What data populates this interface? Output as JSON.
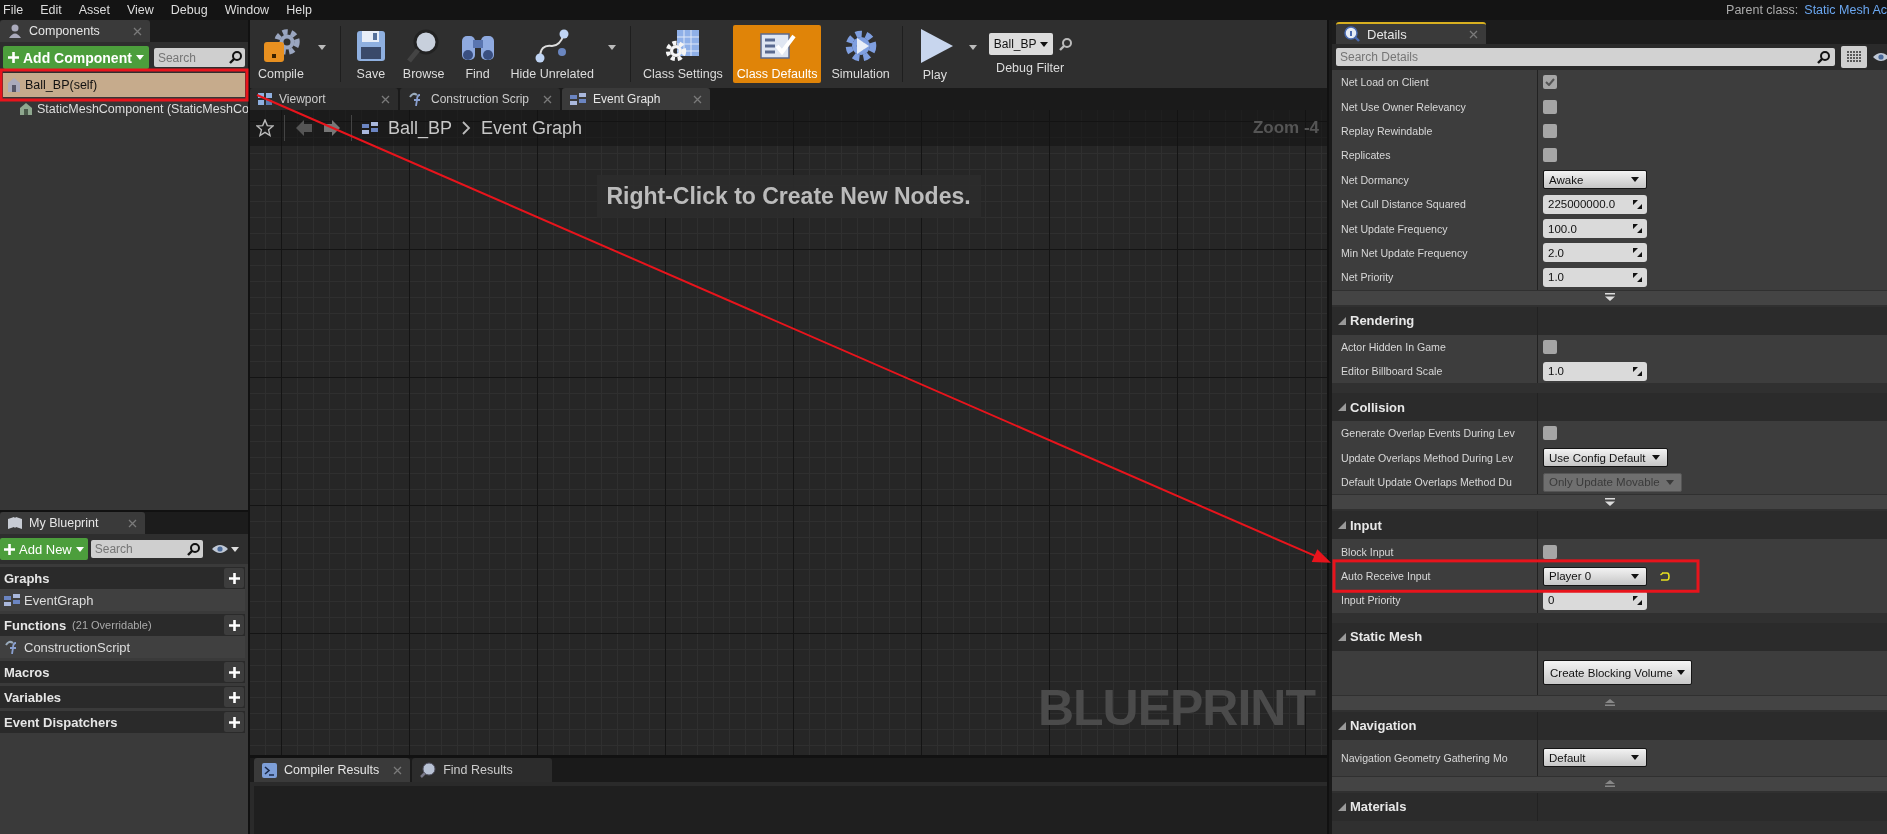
{
  "menu_bar": {
    "items": [
      "File",
      "Edit",
      "Asset",
      "View",
      "Debug",
      "Window",
      "Help"
    ],
    "parent_class_label": "Parent class:",
    "parent_class": "Static Mesh Ac"
  },
  "components_panel": {
    "tab": "Components",
    "add_button": "Add Component",
    "search_placeholder": "Search",
    "tree": [
      {
        "label": "Ball_BP(self)",
        "selected": true,
        "children": [
          {
            "label": "StaticMeshComponent (StaticMeshCo",
            "selected": false
          }
        ]
      }
    ]
  },
  "toolbar": {
    "groups": [
      [
        {
          "label": "Compile",
          "kind": "compile",
          "dropdown": true,
          "selected": false
        }
      ],
      [
        {
          "label": "Save",
          "kind": "save",
          "dropdown": false,
          "selected": false
        },
        {
          "label": "Browse",
          "kind": "browse",
          "dropdown": false,
          "selected": false
        },
        {
          "label": "Find",
          "kind": "find",
          "dropdown": false,
          "selected": false
        },
        {
          "label": "Hide Unrelated",
          "kind": "hide_unrelated",
          "dropdown": true,
          "selected": false
        }
      ],
      [
        {
          "label": "Class Settings",
          "kind": "class_settings",
          "dropdown": false,
          "selected": false
        },
        {
          "label": "Class Defaults",
          "kind": "class_defaults",
          "dropdown": false,
          "selected": true
        },
        {
          "label": "Simulation",
          "kind": "simulation",
          "dropdown": false,
          "selected": false
        }
      ],
      [
        {
          "label": "Play",
          "kind": "play",
          "dropdown": true,
          "selected": false
        }
      ]
    ],
    "debug_filter": {
      "value": "Ball_BP",
      "label": "Debug Filter"
    }
  },
  "editor_tabs": [
    {
      "label": "Viewport",
      "kind": "viewport",
      "selected": false
    },
    {
      "label": "Construction Scrip",
      "kind": "function",
      "selected": false
    },
    {
      "label": "Event Graph",
      "kind": "graph",
      "selected": true
    }
  ],
  "graph": {
    "breadcrumb": [
      "Ball_BP",
      "Event Graph"
    ],
    "zoom": "Zoom -4",
    "hint": "Right-Click to Create New Nodes.",
    "watermark": "BLUEPRINT"
  },
  "bottom_tabs": [
    {
      "label": "Compiler Results",
      "kind": "compiler",
      "selected": true
    },
    {
      "label": "Find Results",
      "kind": "find",
      "selected": false
    }
  ],
  "my_blueprint": {
    "tab": "My Blueprint",
    "add_button": "Add New",
    "search_placeholder": "Search",
    "sections": [
      {
        "title": "Graphs",
        "items": [
          {
            "label": "EventGraph",
            "kind": "graph"
          }
        ]
      },
      {
        "title": "Functions",
        "note": "(21 Overridable)",
        "items": [
          {
            "label": "ConstructionScript",
            "kind": "function"
          }
        ]
      },
      {
        "title": "Macros"
      },
      {
        "title": "Variables"
      },
      {
        "title": "Event Dispatchers"
      }
    ]
  },
  "details": {
    "tab": "Details",
    "search_placeholder": "Search Details",
    "groups": [
      {
        "rows": [
          {
            "name": "Net Load on Client",
            "kind": "checkbox",
            "checked": true,
            "modified": false
          },
          {
            "name": "Net Use Owner Relevancy",
            "kind": "checkbox",
            "checked": false,
            "modified": false
          },
          {
            "name": "Replay Rewindable",
            "kind": "checkbox",
            "checked": false,
            "modified": false
          },
          {
            "name": "Replicates",
            "kind": "checkbox",
            "checked": false,
            "modified": false
          },
          {
            "name": "Net Dormancy",
            "kind": "dropdown",
            "value": "Awake",
            "disabled": false,
            "modified": false
          },
          {
            "name": "Net Cull Distance Squared",
            "kind": "number",
            "value": "225000000.0",
            "modified": false
          },
          {
            "name": "Net Update Frequency",
            "kind": "number",
            "value": "100.0",
            "modified": false
          },
          {
            "name": "Min Net Update Frequency",
            "kind": "number",
            "value": "2.0",
            "modified": false
          },
          {
            "name": "Net Priority",
            "kind": "number",
            "value": "1.0",
            "modified": false
          }
        ],
        "advanced_expanded": false
      },
      {
        "title": "Rendering",
        "rows": [
          {
            "name": "Actor Hidden In Game",
            "kind": "checkbox",
            "checked": false,
            "modified": false
          },
          {
            "name": "Editor Billboard Scale",
            "kind": "number",
            "value": "1.0",
            "modified": false
          }
        ]
      },
      {
        "title": "Collision",
        "rows": [
          {
            "name": "Generate Overlap Events During Lev",
            "kind": "checkbox",
            "checked": false,
            "modified": false
          },
          {
            "name": "Update Overlaps Method During Lev",
            "kind": "dropdown",
            "value": "Use Config Default",
            "disabled": false,
            "modified": false
          },
          {
            "name": "Default Update Overlaps Method Du",
            "kind": "dropdown",
            "value": "Only Update Movable",
            "disabled": true,
            "modified": false
          }
        ],
        "advanced_expanded": false
      },
      {
        "title": "Input",
        "rows": [
          {
            "name": "Block Input",
            "kind": "checkbox",
            "checked": false,
            "modified": false
          },
          {
            "name": "Auto Receive Input",
            "kind": "dropdown",
            "value": "Player 0",
            "disabled": false,
            "modified": true
          },
          {
            "name": "Input Priority",
            "kind": "number",
            "value": "0",
            "modified": false
          }
        ]
      },
      {
        "title": "Static Mesh",
        "rows": [
          {
            "kind": "button",
            "value": "Create Blocking Volume",
            "modified": false
          }
        ],
        "advanced_expanded": true
      },
      {
        "title": "Navigation",
        "rows": [
          {
            "name": "Navigation Geometry Gathering Mo",
            "kind": "dropdown",
            "value": "Default",
            "disabled": false,
            "modified": false
          }
        ],
        "advanced_expanded": true
      },
      {
        "title": "Materials"
      }
    ]
  }
}
